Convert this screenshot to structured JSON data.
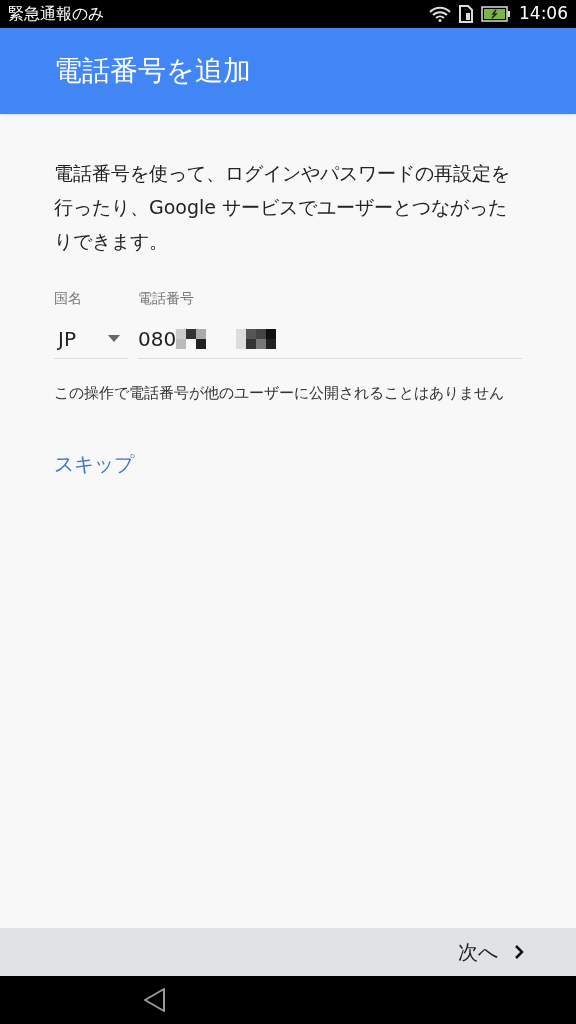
{
  "status_bar": {
    "carrier": "緊急通報のみ",
    "time": "14:06"
  },
  "header": {
    "title": "電話番号を追加"
  },
  "intro": "電話番号を使って、ログインやパスワードの再設定を行ったり、Google サービスでユーザーとつながったりできます。",
  "country": {
    "label": "国名",
    "value": "JP"
  },
  "phone": {
    "label": "電話番号",
    "value": "080"
  },
  "note": "この操作で電話番号が他のユーザーに公開されることはありません",
  "skip_link": "スキップ",
  "next_button": "次へ"
}
